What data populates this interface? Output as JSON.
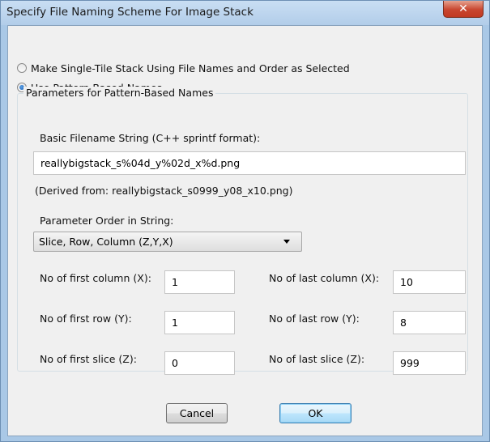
{
  "window": {
    "title": "Specify File Naming Scheme For Image Stack",
    "close_glyph": "✕"
  },
  "mode": {
    "options": [
      {
        "label": "Make Single-Tile Stack Using File Names and Order as Selected",
        "checked": false
      },
      {
        "label": "Use Pattern-Based Names",
        "checked": true
      }
    ]
  },
  "params": {
    "group_title": "Parameters for Pattern-Based Names",
    "filename_label": "Basic Filename String (C++ sprintf format):",
    "filename_value": "reallybigstack_s%04d_y%02d_x%d.png",
    "derived_text": "(Derived from: reallybigstack_s0999_y08_x10.png)",
    "order_label": "Parameter Order in String:",
    "order_value": "Slice, Row, Column (Z,Y,X)",
    "first_col_label": "No of first column (X):",
    "first_col_value": "1",
    "last_col_label": "No of last column (X):",
    "last_col_value": "10",
    "first_row_label": "No of first row (Y):",
    "first_row_value": "1",
    "last_row_label": "No of last row (Y):",
    "last_row_value": "8",
    "first_slice_label": "No of first slice (Z):",
    "first_slice_value": "0",
    "last_slice_label": "No of last slice (Z):",
    "last_slice_value": "999"
  },
  "buttons": {
    "cancel": "Cancel",
    "ok": "OK"
  }
}
